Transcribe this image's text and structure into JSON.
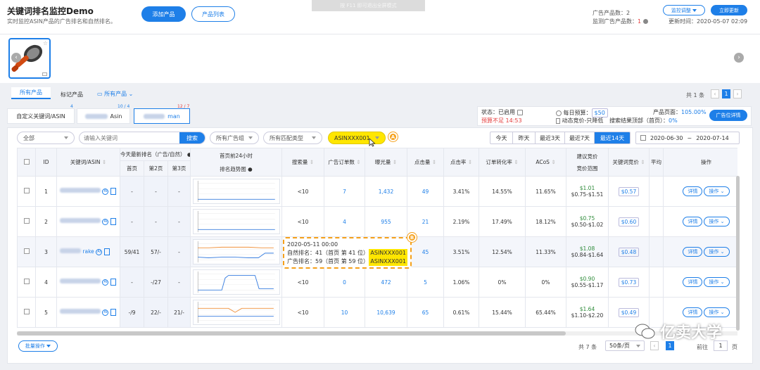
{
  "header": {
    "title": "关键词排名监控Demo",
    "subtitle": "实时监控ASIN产品的广告排名和自然排名。",
    "add_product": "添加产品",
    "product_list": "产品列表",
    "fullscreen_hint": "按 F11 即可退出全屏模式",
    "fullscreen_key": "F11",
    "ad_product_count_label": "广告产品数：",
    "ad_product_count": "2",
    "monitor_ad_count_label": "监测广告产品数：",
    "monitor_ad_count": "1",
    "monitor_adjust": "监控调整",
    "refresh_now": "立即更新",
    "update_time_label": "更新时间：",
    "update_time": "2020-05-07 02:09"
  },
  "tabs": {
    "all_products": "所有产品",
    "marked_products": "标记产品",
    "all_products_dropdown": "所有产品",
    "total": "共 1 条",
    "page": "1"
  },
  "keyword_tabs": [
    {
      "label": "自定义关键词/ASIN",
      "count": "4"
    },
    {
      "label": "Asin",
      "count": "10 / 4"
    },
    {
      "label": "man",
      "count": "12 / 7"
    }
  ],
  "campaign_info": {
    "status_label": "状态：",
    "status": "已启用",
    "budget_short": "预算不足 14:53",
    "daily_budget_label": "每日预算：",
    "daily_budget": "$50",
    "dynamic_bid": "动态竞价-只降低",
    "product_page_label": "产品页面：",
    "product_page": "105.00%",
    "search_top_label": "搜索结果顶部（首页）：",
    "search_top": "0%",
    "ad_detail_button": "广告位详情"
  },
  "filters": {
    "all": "全部",
    "keyword_placeholder": "请输入关键词",
    "search": "搜索",
    "ad_group": "所有广告组",
    "match_type": "所有匹配类型",
    "asin_select": "ASINXXX001",
    "ranges": [
      "今天",
      "昨天",
      "最近3天",
      "最近7天",
      "最近14天"
    ],
    "date_start": "2020-06-30",
    "date_sep": "~",
    "date_end": "2020-07-14"
  },
  "table": {
    "headers": {
      "id": "ID",
      "keyword": "关键词/ASIN",
      "today_rank": "今天最新排名（广告/自然）",
      "page1": "首页",
      "page2": "第2页",
      "page3": "第3页",
      "trend": "首页前24小时",
      "trend2": "排名趋势图",
      "search_volume": "搜索量",
      "ad_orders": "广告订单数",
      "impressions": "曝光量",
      "clicks": "点击量",
      "ctr": "点击率",
      "cvr": "订单转化率",
      "acos": "ACoS",
      "suggest_bid": "建议竞价",
      "bid_range": "竞价范围",
      "kw_bid": "关键词竞价",
      "avg": "平均",
      "ops": "操作"
    },
    "rows": [
      {
        "id": "1",
        "kw": "",
        "p1": "-",
        "p2": "-",
        "p3": "-",
        "sv": "<10",
        "orders": "7",
        "impr": "1,432",
        "clicks": "49",
        "ctr": "3.41%",
        "cvr": "14.55%",
        "acos": "11.65%",
        "bid": "$1.01",
        "range": "$0.75-$1.51",
        "kwbid": "$0.57"
      },
      {
        "id": "2",
        "kw": "",
        "p1": "-",
        "p2": "-",
        "p3": "-",
        "sv": "<10",
        "orders": "4",
        "impr": "955",
        "clicks": "21",
        "ctr": "2.19%",
        "cvr": "17.49%",
        "acos": "18.12%",
        "bid": "$0.75",
        "range": "$0.50-$1.02",
        "kwbid": "$0.60"
      },
      {
        "id": "3",
        "kw": "rake",
        "p1": "59/41",
        "p2": "57/-",
        "p3": "-",
        "sv": "",
        "orders": "",
        "impr": "",
        "clicks": "45",
        "ctr": "3.51%",
        "cvr": "12.54%",
        "acos": "11.33%",
        "bid": "$1.08",
        "range": "$0.84-$1.64",
        "kwbid": "$0.48"
      },
      {
        "id": "4",
        "kw": "",
        "p1": "-",
        "p2": "-/27",
        "p3": "-",
        "sv": "<10",
        "orders": "0",
        "impr": "472",
        "clicks": "5",
        "ctr": "1.06%",
        "cvr": "0%",
        "acos": "0%",
        "bid": "$0.90",
        "range": "$0.55-$1.17",
        "kwbid": "$0.73"
      },
      {
        "id": "5",
        "kw": "",
        "p1": "-/9",
        "p2": "22/-",
        "p3": "21/-",
        "sv": "<10",
        "orders": "10",
        "impr": "10,639",
        "clicks": "65",
        "ctr": "0.61%",
        "cvr": "15.44%",
        "acos": "65.44%",
        "bid": "$1.64",
        "range": "$1.10-$2.20",
        "kwbid": "$0.49"
      }
    ],
    "detail": "详情",
    "operate": "操作"
  },
  "tooltip": {
    "time": "2020-05-11 00:00",
    "natural": "自然排名：41（首页 第 41 位）",
    "ad": "广告排名：59（首页 第 59 位）",
    "asin1": "ASINXXX001",
    "asin2": "ASINXXX001"
  },
  "badges": {
    "a": "A",
    "b": "B"
  },
  "footer": {
    "batch": "批量操作",
    "total": "共 7 条",
    "per_page": "50条/页",
    "page": "1",
    "goto": "前往",
    "goto_page": "1",
    "page_unit": "页"
  },
  "watermark": "亿卖大学",
  "colors": {
    "accent": "#1e7fe8",
    "highlight": "#ffe600",
    "badge": "#f5a01a",
    "warn": "#e43c3c"
  }
}
